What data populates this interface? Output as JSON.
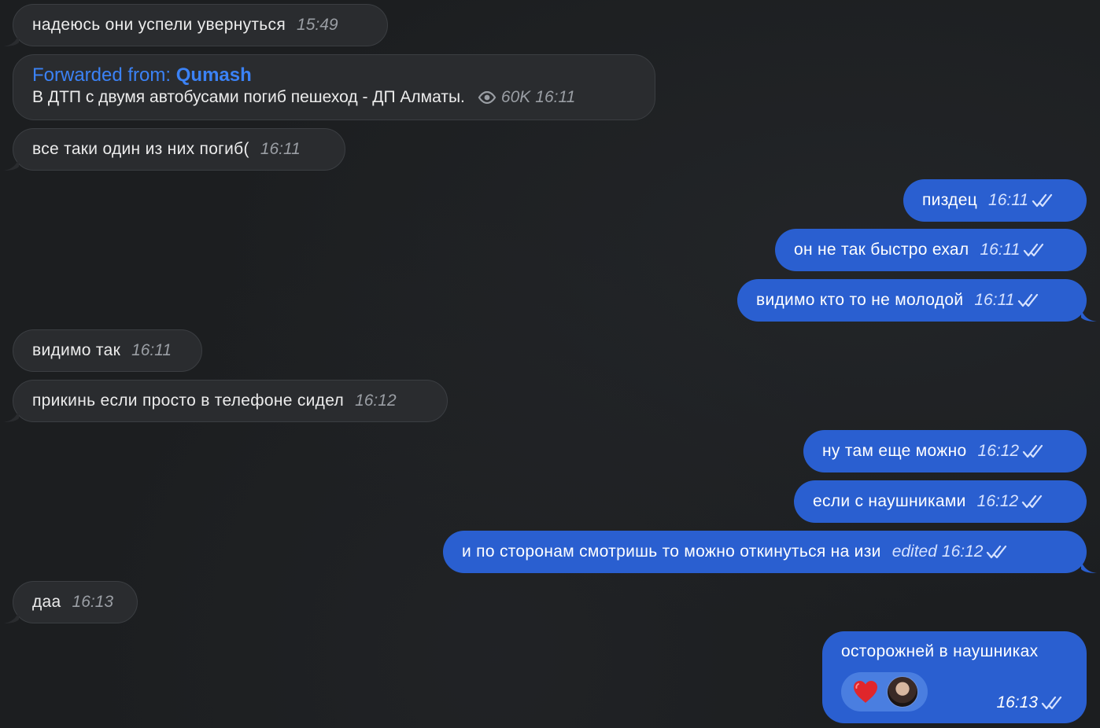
{
  "chat": {
    "messages": [
      {
        "side": "in",
        "text": "надеюсь они успели увернуться",
        "time": "15:49"
      },
      {
        "side": "in",
        "forwarded_label": "Forwarded from:",
        "forwarded_source": "Qumash",
        "text": "В ДТП с двумя автобусами погиб пешеход - ДП Алматы.",
        "views": "60K",
        "time": "16:11"
      },
      {
        "side": "in",
        "text": "все таки один из них погиб(",
        "time": "16:11"
      },
      {
        "side": "out",
        "text": "пиздец",
        "time": "16:11"
      },
      {
        "side": "out",
        "text": "он не так быстро ехал",
        "time": "16:11"
      },
      {
        "side": "out",
        "text": "видимо кто то не молодой",
        "time": "16:11"
      },
      {
        "side": "in",
        "text": "видимо так",
        "time": "16:11"
      },
      {
        "side": "in",
        "text": "прикинь если просто в телефоне сидел",
        "time": "16:12"
      },
      {
        "side": "out",
        "text": "ну там еще можно",
        "time": "16:12"
      },
      {
        "side": "out",
        "text": "если с наушниками",
        "time": "16:12"
      },
      {
        "side": "out",
        "text": "и по сторонам смотришь то можно откинуться на изи",
        "edited_label": "edited",
        "time": "16:12"
      },
      {
        "side": "in",
        "text": "даа",
        "time": "16:13"
      },
      {
        "side": "out",
        "text": "осторожней в наушниках",
        "time": "16:13",
        "reaction": "heart"
      }
    ]
  },
  "colors": {
    "incoming_bubble": "#2a2c2f",
    "outgoing_bubble": "#2a5fd0",
    "forward_header": "#3b82f6",
    "background": "#1c1e20"
  },
  "icons": [
    "double-check-icon",
    "eye-icon",
    "heart-icon"
  ]
}
